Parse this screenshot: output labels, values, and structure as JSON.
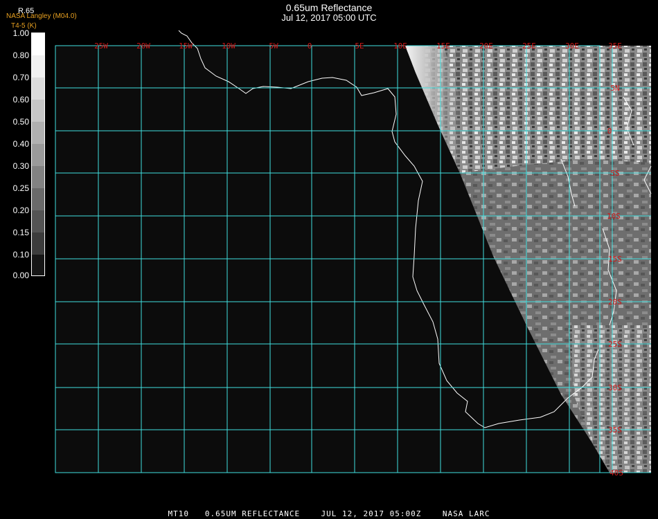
{
  "title_line1": "0.65um Reflectance",
  "title_line2": "Jul 12, 2017 05:00 UTC",
  "top_left": {
    "band_label": "R.65",
    "source": "NASA Langley (M04.0)",
    "sub_label": "T4-5 (K)"
  },
  "color_scale": {
    "ticks": [
      "1.00",
      "0.80",
      "0.70",
      "0.60",
      "0.50",
      "0.40",
      "0.30",
      "0.25",
      "0.20",
      "0.15",
      "0.10",
      "0.00"
    ]
  },
  "grid": {
    "lon_labels": [
      "25W",
      "20W",
      "15W",
      "10W",
      "5W",
      "0",
      "5E",
      "10E",
      "15E",
      "20E",
      "25E",
      "30E",
      "35E"
    ],
    "lat_labels": [
      "5N",
      "0",
      "5S",
      "10S",
      "15S",
      "20S",
      "25S",
      "30S",
      "35S",
      "40S"
    ],
    "grid_color": "#40e0e0",
    "label_color": "#d01818"
  },
  "footer": "MT10   0.65UM REFLECTANCE    JUL 12, 2017 05:00Z    NASA LARC"
}
